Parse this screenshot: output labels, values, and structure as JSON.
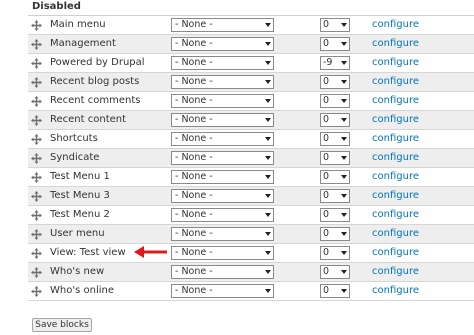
{
  "section": {
    "title": "Disabled"
  },
  "blocks": [
    {
      "name": "Main menu",
      "region": "- None -",
      "weight": "0",
      "action": "configure"
    },
    {
      "name": "Management",
      "region": "- None -",
      "weight": "0",
      "action": "configure"
    },
    {
      "name": "Powered by Drupal",
      "region": "- None -",
      "weight": "-9",
      "action": "configure"
    },
    {
      "name": "Recent blog posts",
      "region": "- None -",
      "weight": "0",
      "action": "configure"
    },
    {
      "name": "Recent comments",
      "region": "- None -",
      "weight": "0",
      "action": "configure"
    },
    {
      "name": "Recent content",
      "region": "- None -",
      "weight": "0",
      "action": "configure"
    },
    {
      "name": "Shortcuts",
      "region": "- None -",
      "weight": "0",
      "action": "configure"
    },
    {
      "name": "Syndicate",
      "region": "- None -",
      "weight": "0",
      "action": "configure"
    },
    {
      "name": "Test Menu 1",
      "region": "- None -",
      "weight": "0",
      "action": "configure"
    },
    {
      "name": "Test Menu 3",
      "region": "- None -",
      "weight": "0",
      "action": "configure"
    },
    {
      "name": "Test Menu 2",
      "region": "- None -",
      "weight": "0",
      "action": "configure"
    },
    {
      "name": "User menu",
      "region": "- None -",
      "weight": "0",
      "action": "configure"
    },
    {
      "name": "View: Test view",
      "region": "- None -",
      "weight": "0",
      "action": "configure"
    },
    {
      "name": "Who's new",
      "region": "- None -",
      "weight": "0",
      "action": "configure"
    },
    {
      "name": "Who's online",
      "region": "- None -",
      "weight": "0",
      "action": "configure"
    }
  ],
  "annotation": {
    "color": "#e0181b",
    "icon": "red-arrow-left-icon"
  },
  "colors": {
    "link": "#0074bd",
    "row_even": "#eeeeee",
    "row_odd": "#ffffff"
  },
  "footer": {
    "save_label": "Save blocks"
  }
}
